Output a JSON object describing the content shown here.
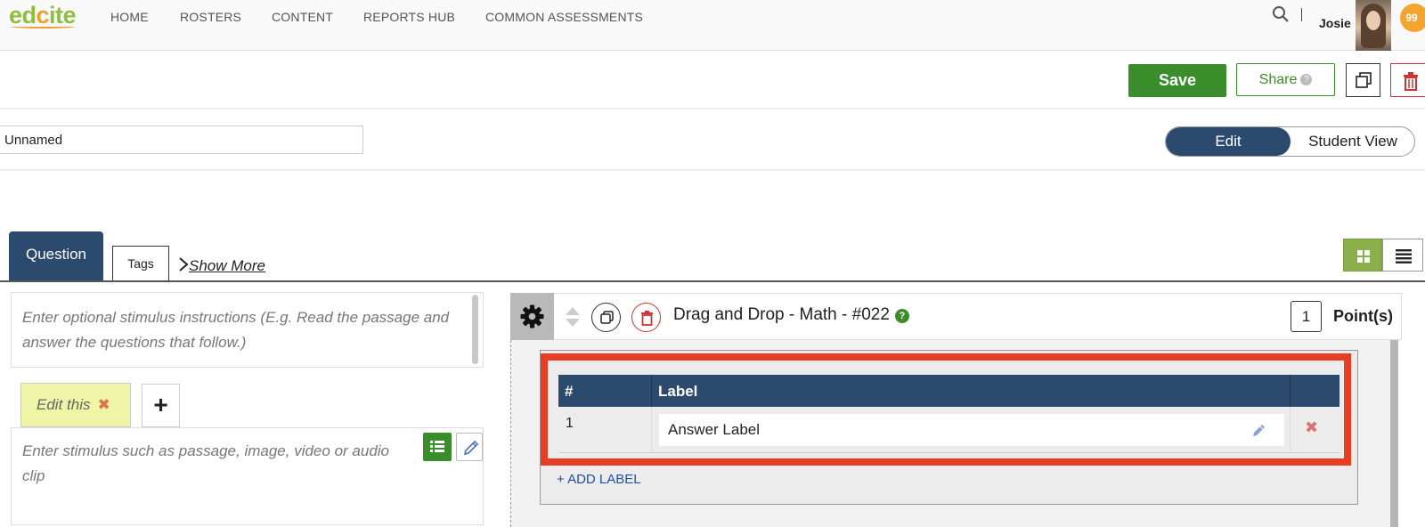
{
  "brand": {
    "logo_part1": "ed",
    "logo_part2": "c",
    "logo_part3": "ite"
  },
  "nav": {
    "items": [
      "HOME",
      "ROSTERS",
      "CONTENT",
      "REPORTS HUB",
      "COMMON ASSESSMENTS"
    ],
    "user_name": "Josie",
    "notification_count": "99"
  },
  "toolbar": {
    "save_label": "Save",
    "share_label": "Share"
  },
  "assessment": {
    "name_value": "Unnamed"
  },
  "view_toggle": {
    "edit_label": "Edit",
    "student_label": "Student View",
    "active": "Edit"
  },
  "tabs": {
    "question": "Question",
    "tags": "Tags",
    "show_more": "Show More"
  },
  "stimulus": {
    "instructions_placeholder": "Enter optional stimulus instructions (E.g. Read the passage and answer the questions that follow.)",
    "tab_label": "Edit this",
    "tab_remove": "✖",
    "add_tab": "+",
    "content_placeholder": "Enter stimulus such as passage, image, video or audio clip"
  },
  "question": {
    "title": "Drag and Drop - Math - #022",
    "help": "?",
    "points_value": "1",
    "points_label": "Point(s)"
  },
  "labels_table": {
    "headers": [
      "#",
      "Label"
    ],
    "rows": [
      {
        "num": "1",
        "label": "Answer Label",
        "remove": "✖"
      }
    ],
    "add_label": "+ ADD LABEL"
  },
  "colors": {
    "brand_navy": "#2c4a6e",
    "save_green": "#3b8c2a",
    "highlight_red": "#e63d23",
    "grid_view_green": "#8bb04b",
    "badge_orange": "#f3a530"
  },
  "icons": [
    "search-icon",
    "copy-icon",
    "trash-icon",
    "gear-icon",
    "reorder-arrows-icon",
    "grid-icon",
    "list-icon",
    "pencil-icon",
    "chevron-right-icon",
    "help-icon",
    "close-icon"
  ]
}
